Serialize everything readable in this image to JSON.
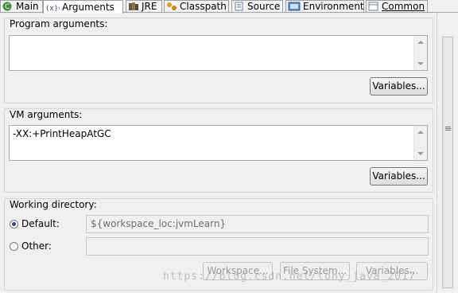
{
  "tabs": [
    {
      "label": "Main",
      "icon": "main-launch-icon",
      "active": false
    },
    {
      "label": "Arguments",
      "icon": "arguments-icon",
      "active": true
    },
    {
      "label": "JRE",
      "icon": "jre-library-icon",
      "active": false
    },
    {
      "label": "Classpath",
      "icon": "classpath-icon",
      "active": false
    },
    {
      "label": "Source",
      "icon": "source-icon",
      "active": false
    },
    {
      "label": "Environment",
      "icon": "environment-icon",
      "active": false
    },
    {
      "label": "Common",
      "icon": "common-icon",
      "active": false
    }
  ],
  "program_args": {
    "title": "Program arguments:",
    "value": "",
    "variables_button": "Variables..."
  },
  "vm_args": {
    "title": "VM arguments:",
    "value": "-XX:+PrintHeapAtGC",
    "variables_button": "Variables..."
  },
  "working_dir": {
    "title": "Working directory:",
    "default_label": "Default:",
    "default_checked": true,
    "default_value": "${workspace_loc:jvmLearn}",
    "other_label": "Other:",
    "other_checked": false,
    "other_value": "",
    "buttons": {
      "workspace": "Workspace...",
      "file_system": "File System...",
      "variables": "Variables..."
    }
  },
  "watermark": "https://blog.csdn.net/tony_java_2017"
}
